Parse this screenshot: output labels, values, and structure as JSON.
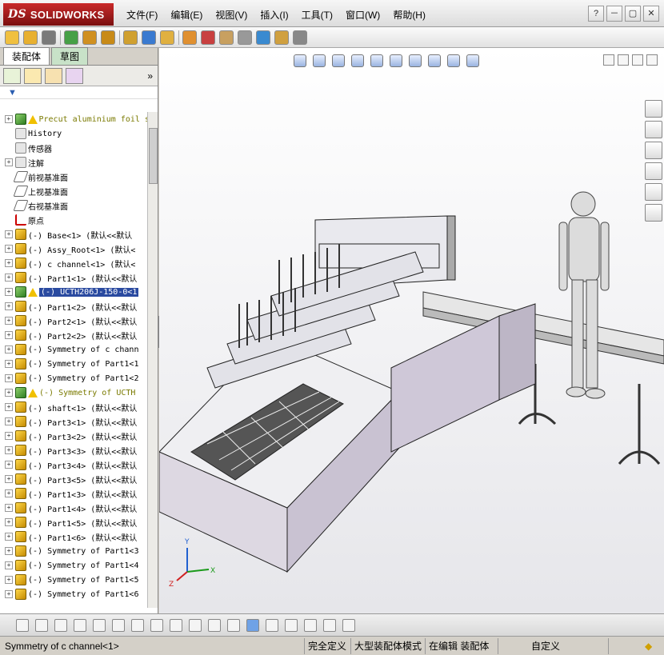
{
  "app": {
    "logo_ds": "DS",
    "logo_text": "SOLIDWORKS"
  },
  "menu": [
    "文件(F)",
    "编辑(E)",
    "视图(V)",
    "插入(I)",
    "工具(T)",
    "窗口(W)",
    "帮助(H)"
  ],
  "title_buttons": [
    "?",
    "－",
    "▢",
    "✕"
  ],
  "panel_tabs": [
    "装配体",
    "草图"
  ],
  "fm_tabs": [
    "feature-manager",
    "property-manager",
    "configuration-manager",
    "display-manager"
  ],
  "filter_icon": "funnel-icon",
  "tree": [
    {
      "label": "Precut aluminium foil se",
      "icon": "assembly",
      "warn": true,
      "exp": true,
      "root": true
    },
    {
      "label": "History",
      "icon": "history",
      "exp": false
    },
    {
      "label": "传感器",
      "icon": "history",
      "exp": false
    },
    {
      "label": "注解",
      "icon": "annotation",
      "exp": true
    },
    {
      "label": "前视基准面",
      "icon": "plane",
      "exp": false
    },
    {
      "label": "上视基准面",
      "icon": "plane",
      "exp": false
    },
    {
      "label": "右视基准面",
      "icon": "plane",
      "exp": false
    },
    {
      "label": "原点",
      "icon": "origin",
      "exp": false
    },
    {
      "label": "(-) Base<1> (默认<<默认",
      "icon": "part",
      "exp": true
    },
    {
      "label": "(-) Assy_Root<1> (默认<",
      "icon": "part",
      "exp": true
    },
    {
      "label": "(-) c channel<1> (默认<",
      "icon": "part",
      "exp": true
    },
    {
      "label": "(-) Part1<1> (默认<<默认",
      "icon": "part",
      "exp": true
    },
    {
      "label": "(-) UCTH206J-150-0<1",
      "icon": "assembly",
      "warn": true,
      "exp": true,
      "selected": true
    },
    {
      "label": "(-) Part1<2> (默认<<默认",
      "icon": "part",
      "exp": true
    },
    {
      "label": "(-) Part2<1> (默认<<默认",
      "icon": "part",
      "exp": true
    },
    {
      "label": "(-) Part2<2> (默认<<默认",
      "icon": "part",
      "exp": true
    },
    {
      "label": "(-) Symmetry of c chann",
      "icon": "part",
      "exp": true
    },
    {
      "label": "(-) Symmetry of Part1<1",
      "icon": "part",
      "exp": true
    },
    {
      "label": "(-) Symmetry of Part1<2",
      "icon": "part",
      "exp": true
    },
    {
      "label": "(-) Symmetry of UCTH",
      "icon": "assembly",
      "warn": true,
      "exp": true,
      "root": true
    },
    {
      "label": "(-) shaft<1> (默认<<默认",
      "icon": "part",
      "exp": true
    },
    {
      "label": "(-) Part3<1> (默认<<默认",
      "icon": "part",
      "exp": true
    },
    {
      "label": "(-) Part3<2> (默认<<默认",
      "icon": "part",
      "exp": true
    },
    {
      "label": "(-) Part3<3> (默认<<默认",
      "icon": "part",
      "exp": true
    },
    {
      "label": "(-) Part3<4> (默认<<默认",
      "icon": "part",
      "exp": true
    },
    {
      "label": "(-) Part3<5> (默认<<默认",
      "icon": "part",
      "exp": true
    },
    {
      "label": "(-) Part1<3> (默认<<默认",
      "icon": "part",
      "exp": true
    },
    {
      "label": "(-) Part1<4> (默认<<默认",
      "icon": "part",
      "exp": true
    },
    {
      "label": "(-) Part1<5> (默认<<默认",
      "icon": "part",
      "exp": true
    },
    {
      "label": "(-) Part1<6> (默认<<默认",
      "icon": "part",
      "exp": true
    },
    {
      "label": "(-) Symmetry of Part1<3",
      "icon": "part",
      "exp": true
    },
    {
      "label": "(-) Symmetry of Part1<4",
      "icon": "part",
      "exp": true
    },
    {
      "label": "(-) Symmetry of Part1<5",
      "icon": "part",
      "exp": true
    },
    {
      "label": "(-) Symmetry of Part1<6",
      "icon": "part",
      "exp": true
    }
  ],
  "axes": {
    "x": "X",
    "y": "Y",
    "z": "Z"
  },
  "status": {
    "selection": "Symmetry of c channel<1>",
    "definition": "完全定义",
    "mode": "大型装配体模式",
    "editing": "在编辑 装配体",
    "custom": "自定义"
  },
  "colors": {
    "accent": "#2a4aa0",
    "brand": "#b01e1e"
  }
}
